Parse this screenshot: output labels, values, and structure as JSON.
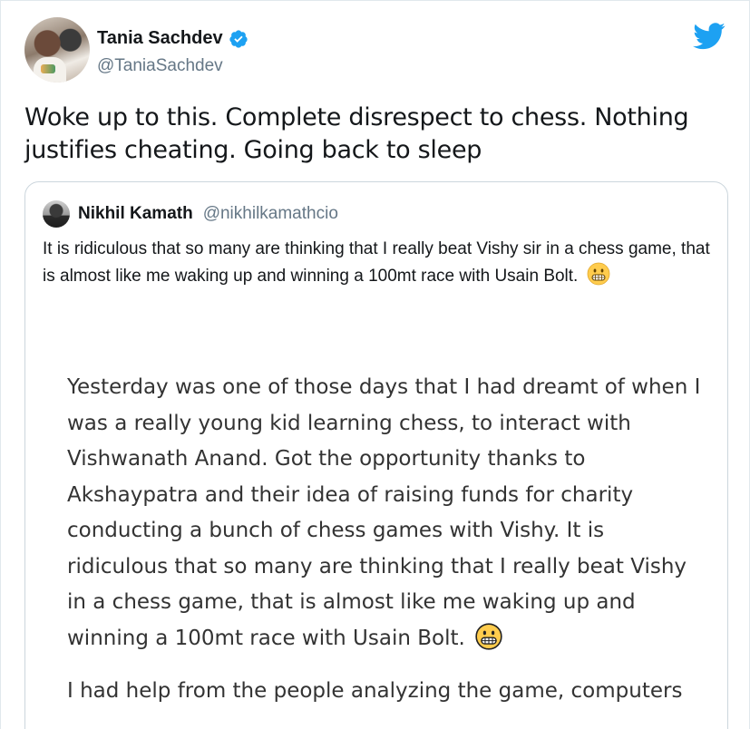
{
  "tweet": {
    "author": {
      "display_name": "Tania Sachdev",
      "handle": "@TaniaSachdev",
      "verified": true
    },
    "text": "Woke up to this. Complete disrespect to chess. Nothing justifies cheating. Going back to sleep",
    "brand_icon": "twitter-bird-icon",
    "brand_color": "#1da1f2"
  },
  "quoted_tweet": {
    "author": {
      "display_name": "Nikhil Kamath",
      "handle": "@nikhilkamathcio"
    },
    "text": "It is ridiculous that so many are thinking that I really beat Vishy sir in a chess game, that is almost like me waking up and winning a 100mt race with Usain Bolt.",
    "emoji": "grimacing-face-icon",
    "media": {
      "paragraph_1": "Yesterday was one of those days that I had dreamt of when I was a really young kid learning chess, to interact with Vishwanath Anand. Got the opportunity thanks to Akshaypatra and their idea of raising funds for charity conducting a bunch of chess games with Vishy. It is ridiculous that so many are thinking that I really beat Vishy in a chess game, that is almost like me waking up and winning a 100mt race with Usain Bolt.",
      "paragraph_2": "I had help from the people analyzing the game, computers"
    }
  }
}
